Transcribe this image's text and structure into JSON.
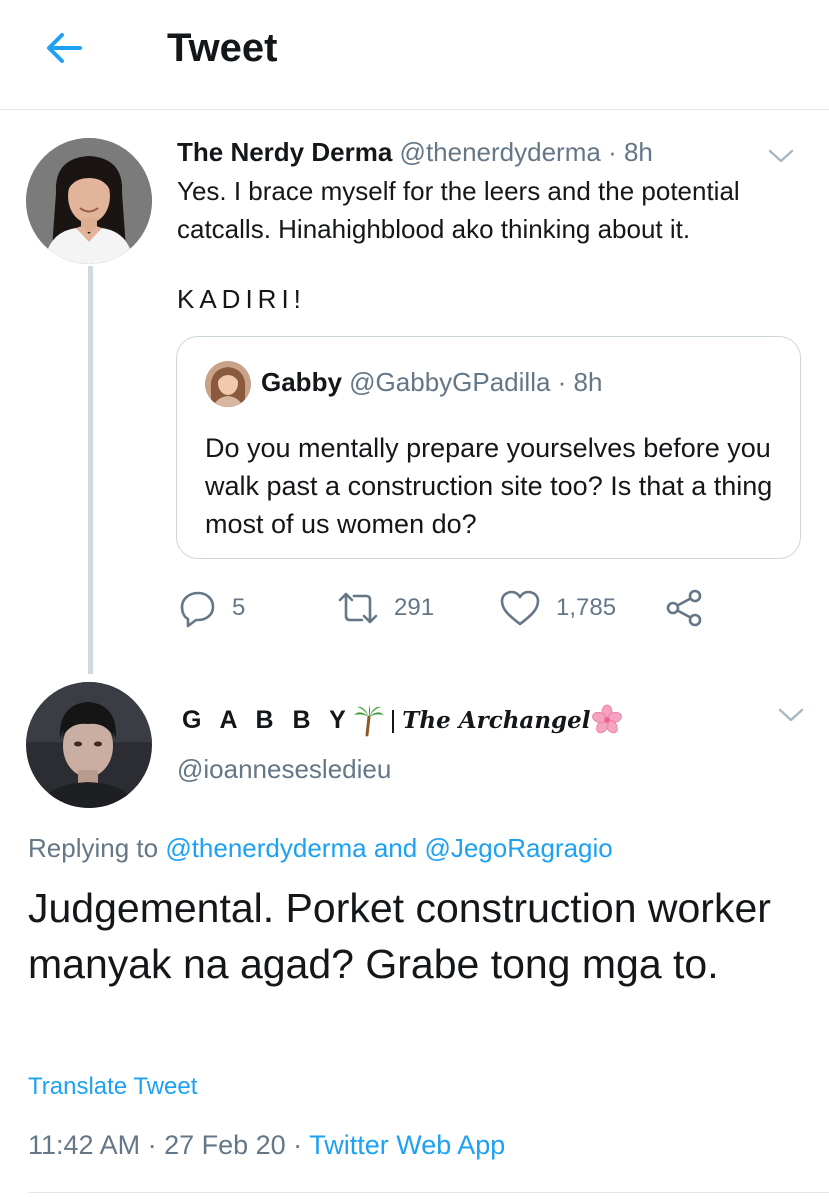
{
  "header": {
    "title": "Tweet",
    "back_icon": "back-arrow-icon"
  },
  "colors": {
    "accent": "#1da1f2",
    "secondary_text": "#657786",
    "divider": "#e1e8ed"
  },
  "parent_tweet": {
    "name": "The Nerdy Derma",
    "handle": "@thenerdyderma",
    "time": "· 8h",
    "text": "Yes. I brace myself for the leers and the potential catcalls. Hinahighblood ako thinking about it.",
    "text2": "KADIRI!",
    "quoted": {
      "name": "Gabby",
      "handle": "@GabbyGPadilla",
      "time": "· 8h",
      "text": "Do you mentally prepare yourselves before you walk past a construction site too? Is that a thing most of us women do?"
    },
    "actions": {
      "replies": "5",
      "retweets": "291",
      "likes": "1,785"
    }
  },
  "reply_tweet": {
    "name_part1": "G A B B Y",
    "name_separator": "|",
    "name_part2": "The Archangel",
    "handle": "@ioannesesledieu",
    "replying_prefix": "Replying to",
    "replying_mention1": "@thenerdyderma",
    "replying_and": "and",
    "replying_mention2": "@JegoRagragio",
    "text": "Judgemental. Porket construction worker manyak na agad? Grabe tong mga to.",
    "translate_label": "Translate Tweet",
    "time": "11:42 AM",
    "date": "· 27 Feb 20 ·",
    "app": "Twitter Web App"
  }
}
